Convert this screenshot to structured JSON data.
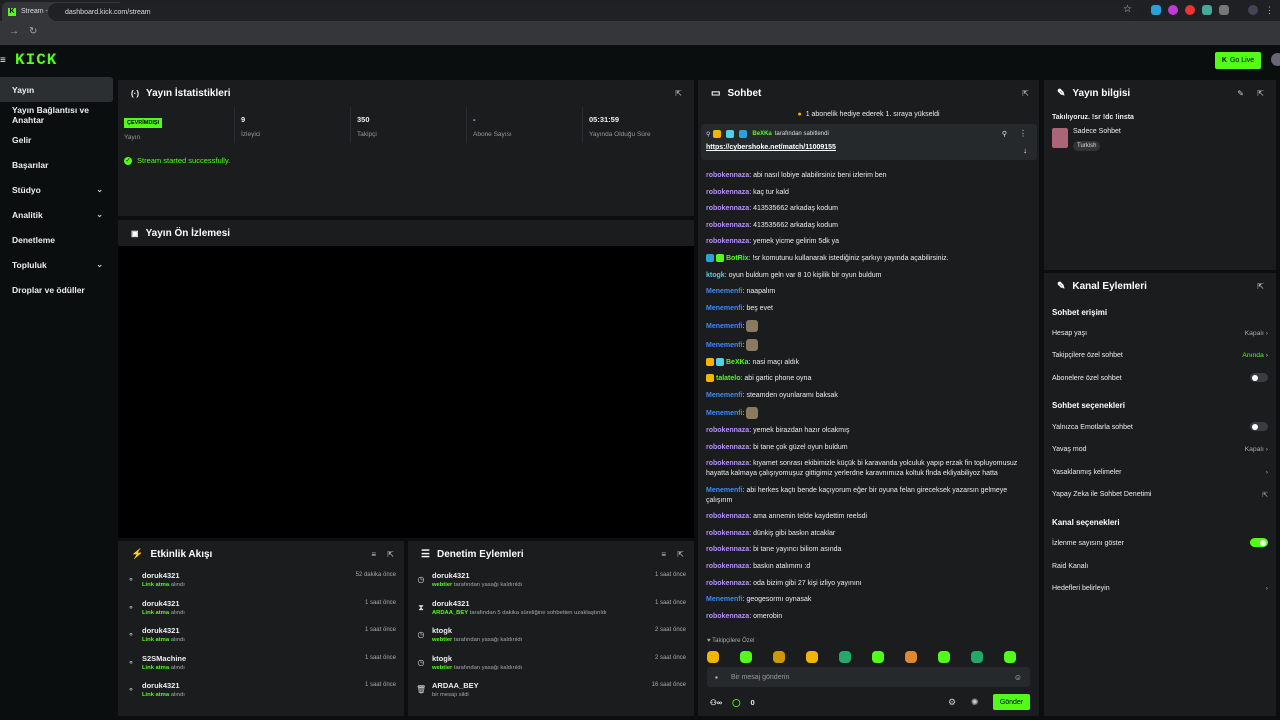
{
  "browser": {
    "tab_title": "Stream - Kick Dashboard",
    "url": "dashboard.kick.com/stream"
  },
  "nav": {
    "logo": "KICK",
    "go_live": "Go Live"
  },
  "sidebar": {
    "items": [
      {
        "label": "Yayın",
        "active": true,
        "chevron": false
      },
      {
        "label": "Yayın Bağlantısı ve Anahtar",
        "active": false,
        "chevron": false
      },
      {
        "label": "Gelir",
        "active": false,
        "chevron": false
      },
      {
        "label": "Başarılar",
        "active": false,
        "chevron": false
      },
      {
        "label": "Stüdyo",
        "active": false,
        "chevron": true
      },
      {
        "label": "Analitik",
        "active": false,
        "chevron": true
      },
      {
        "label": "Denetleme",
        "active": false,
        "chevron": false
      },
      {
        "label": "Topluluk",
        "active": false,
        "chevron": true
      },
      {
        "label": "Droplar ve ödüller",
        "active": false,
        "chevron": false
      }
    ]
  },
  "stats": {
    "title": "Yayın İstatistikleri",
    "status_badge": "ÇEVRİMDIŞI",
    "cells": [
      {
        "value": "",
        "label": "Yayın"
      },
      {
        "value": "9",
        "label": "İzleyici"
      },
      {
        "value": "350",
        "label": "Takipçi"
      },
      {
        "value": "-",
        "label": "Abone Sayısı"
      },
      {
        "value": "05:31:59",
        "label": "Yayında Olduğu Süre"
      }
    ],
    "success_message": "Stream started successfully."
  },
  "preview": {
    "title": "Yayın Ön İzlemesi"
  },
  "activity": {
    "title": "Etkinlik Akışı",
    "items": [
      {
        "name": "doruk4321",
        "action": "Link atma",
        "suffix": "alındı",
        "time": "52 dakika önce"
      },
      {
        "name": "doruk4321",
        "action": "Link atma",
        "suffix": "alındı",
        "time": "1 saat önce"
      },
      {
        "name": "doruk4321",
        "action": "Link atma",
        "suffix": "alındı",
        "time": "1 saat önce"
      },
      {
        "name": "S2SMachine",
        "action": "Link atma",
        "suffix": "alındı",
        "time": "1 saat önce"
      },
      {
        "name": "doruk4321",
        "action": "Link atma",
        "suffix": "alındı",
        "time": "1 saat önce"
      }
    ]
  },
  "modlog": {
    "title": "Denetim Eylemleri",
    "items": [
      {
        "name": "doruk4321",
        "actor": "webtier",
        "detail": "tarafından yasağı kaldırıldı",
        "time": "1 saat önce",
        "icon": "clock-icon"
      },
      {
        "name": "doruk4321",
        "actor": "ARDAA_BEY",
        "detail": "tarafından 5 dakika süreliğine sohbetten uzaklaştırıldı",
        "time": "1 saat önce",
        "icon": "hourglass-icon"
      },
      {
        "name": "ktogk",
        "actor": "webtier",
        "detail": "tarafından yasağı kaldırıldı",
        "time": "2 saat önce",
        "icon": "clock-icon"
      },
      {
        "name": "ktogk",
        "actor": "webtier",
        "detail": "tarafından yasağı kaldırıldı",
        "time": "2 saat önce",
        "icon": "clock-icon"
      },
      {
        "name": "ARDAA_BEY",
        "actor": "",
        "detail": "bir mesajı sildi",
        "time": "16 saat önce",
        "icon": "trash-icon"
      }
    ]
  },
  "chat": {
    "title": "Sohbet",
    "gift_banner": "1 abonelik hediye ederek 1. sıraya yükseldi",
    "pinned": {
      "by": "BeXKa",
      "by_suffix": "tarafından sabitlendi",
      "link": "https://cybershoke.net/match/11009155"
    },
    "messages": [
      {
        "user": "robokennaza",
        "color": "#b892ff",
        "text": "abi nasıl lobiye alabilirsiniz beni izlerim ben"
      },
      {
        "user": "robokennaza",
        "color": "#b892ff",
        "text": "kaç tur kald"
      },
      {
        "user": "robokennaza",
        "color": "#b892ff",
        "text": "413535662 arkadaş kodum"
      },
      {
        "user": "robokennaza",
        "color": "#b892ff",
        "text": "413535662 arkadaş kodum"
      },
      {
        "user": "robokennaza",
        "color": "#b892ff",
        "text": "yemek yicme gelirim 5dk ya"
      },
      {
        "user": "BotRix",
        "color": "#53fc18",
        "text": "!sr komutunu kullanarak istediğiniz şarkıyı yayında açabilirsiniz."
      },
      {
        "user": "ktogk",
        "color": "#4fd1e8",
        "text": "oyun buldum geln var 8 10 kişilik bir oyun buldum"
      },
      {
        "user": "Menemenfi",
        "color": "#3d8bff",
        "text": "naapalım"
      },
      {
        "user": "Menemenfi",
        "color": "#3d8bff",
        "text": "beş evet"
      },
      {
        "user": "Menemenfi",
        "color": "#3d8bff",
        "text": ""
      },
      {
        "user": "Menemenfi",
        "color": "#3d8bff",
        "text": ""
      },
      {
        "user": "BeXKa",
        "color": "#53fc18",
        "text": "nasi maçı aldık"
      },
      {
        "user": "talatelo",
        "color": "#53fc18",
        "text": "abi gartic phone oyna"
      },
      {
        "user": "Menemenfi",
        "color": "#3d8bff",
        "text": "steamden oyunlaramı baksak"
      },
      {
        "user": "Menemenfi",
        "color": "#3d8bff",
        "text": ""
      },
      {
        "user": "robokennaza",
        "color": "#b892ff",
        "text": "yemek birazdan hazır olcakmış"
      },
      {
        "user": "robokennaza",
        "color": "#b892ff",
        "text": "bi tane çok güzel oyun buldum"
      },
      {
        "user": "robokennaza",
        "color": "#b892ff",
        "text": "kıyamet sonrası ekibimizle küçük bi karavanda yolculuk yapıp erzak fin topluyomusuz hayatta kalmaya çalışıyomuşuz gittigimiz yerlerdne karavnımıza koltuk flnda ekliyabiliyoz hatta"
      },
      {
        "user": "Menemenfi",
        "color": "#3d8bff",
        "text": "abi herkes kaçtı bende kaçıyorum eğer bir oyuna felan gireceksek yazarsın gelmeye çalışırım"
      },
      {
        "user": "robokennaza",
        "color": "#b892ff",
        "text": "ama annemin telde kaydettim reelsdi"
      },
      {
        "user": "robokennaza",
        "color": "#b892ff",
        "text": "dünkiş gibi baskın atcaklar"
      },
      {
        "user": "robokennaza",
        "color": "#b892ff",
        "text": "bi tane yayıncı biliom asında"
      },
      {
        "user": "robokennaza",
        "color": "#b892ff",
        "text": "baskın atalımmı :d"
      },
      {
        "user": "robokennaza",
        "color": "#b892ff",
        "text": "oda bizim gibi 27 kişi izliyo yayınını"
      },
      {
        "user": "Menemenfi",
        "color": "#3d8bff",
        "text": "geogesormı oynasak"
      },
      {
        "user": "robokennaza",
        "color": "#b892ff",
        "text": "omerobin"
      }
    ],
    "followers_only": "Takipçilere Özel",
    "input_placeholder": "Bir mesaj gönderin",
    "viewer_count": "0",
    "send": "Gönder"
  },
  "info": {
    "title": "Yayın bilgisi",
    "stream_title": "Takılıyoruz. !sr !dc !insta",
    "category": "Sadece Sohbet",
    "language": "Turkish"
  },
  "actions": {
    "title": "Kanal Eylemleri",
    "chat_access": "Sohbet erişimi",
    "account_age": "Hesap yaşı",
    "account_age_val": "Kapalı",
    "followers_chat": "Takipçilere özel sohbet",
    "followers_chat_val": "Anında",
    "subs_chat": "Abonelere özel sohbet",
    "chat_options": "Sohbet seçenekleri",
    "emote_only": "Yalnızca Emotlarla sohbet",
    "slow_mode": "Yavaş mod",
    "slow_mode_val": "Kapalı",
    "banned_words": "Yasaklanmış kelimeler",
    "ai_mod": "Yapay Zeka ile Sohbet Denetimi",
    "channel_options": "Kanal seçenekleri",
    "show_viewers": "İzlenme sayısını göster",
    "raid": "Raid Kanalı",
    "goals": "Hedefleri belirleyin"
  },
  "colors": {
    "accent": "#53fc18",
    "panel": "#1a1c1e",
    "bg": "#0b0e0f"
  }
}
